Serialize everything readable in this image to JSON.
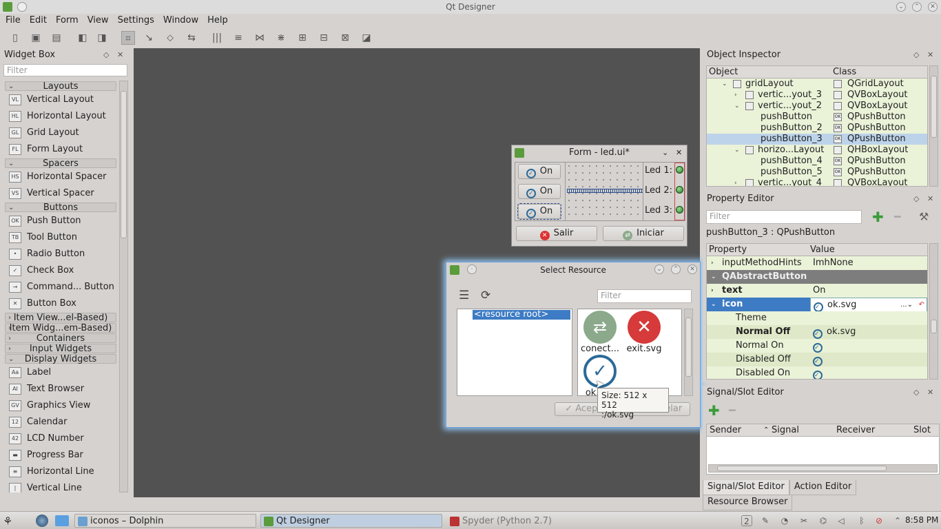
{
  "window": {
    "title": "Qt Designer"
  },
  "menu": [
    "File",
    "Edit",
    "Form",
    "View",
    "Settings",
    "Window",
    "Help"
  ],
  "widget_box": {
    "title": "Widget Box",
    "filter_placeholder": "Filter",
    "sections": [
      {
        "type": "cat",
        "label": "Layouts",
        "open": true
      },
      {
        "type": "item",
        "label": "Vertical Layout",
        "icon": "VL"
      },
      {
        "type": "item",
        "label": "Horizontal Layout",
        "icon": "HL"
      },
      {
        "type": "item",
        "label": "Grid Layout",
        "icon": "GL"
      },
      {
        "type": "item",
        "label": "Form Layout",
        "icon": "FL"
      },
      {
        "type": "cat",
        "label": "Spacers",
        "open": true
      },
      {
        "type": "item",
        "label": "Horizontal Spacer",
        "icon": "HS"
      },
      {
        "type": "item",
        "label": "Vertical Spacer",
        "icon": "VS"
      },
      {
        "type": "cat",
        "label": "Buttons",
        "open": true
      },
      {
        "type": "item",
        "label": "Push Button",
        "icon": "OK"
      },
      {
        "type": "item",
        "label": "Tool Button",
        "icon": "TB"
      },
      {
        "type": "item",
        "label": "Radio Button",
        "icon": "•"
      },
      {
        "type": "item",
        "label": "Check Box",
        "icon": "✓"
      },
      {
        "type": "item",
        "label": "Command... Button",
        "icon": "→"
      },
      {
        "type": "item",
        "label": "Button Box",
        "icon": "✕"
      },
      {
        "type": "cat",
        "label": "Item View...el-Based)",
        "open": false
      },
      {
        "type": "cat",
        "label": "Item Widg...em-Based)",
        "open": false
      },
      {
        "type": "cat",
        "label": "Containers",
        "open": false
      },
      {
        "type": "cat",
        "label": "Input Widgets",
        "open": false
      },
      {
        "type": "cat",
        "label": "Display Widgets",
        "open": true
      },
      {
        "type": "item",
        "label": "Label",
        "icon": "Aa"
      },
      {
        "type": "item",
        "label": "Text Browser",
        "icon": "AI"
      },
      {
        "type": "item",
        "label": "Graphics View",
        "icon": "GV"
      },
      {
        "type": "item",
        "label": "Calendar",
        "icon": "12"
      },
      {
        "type": "item",
        "label": "LCD Number",
        "icon": "42"
      },
      {
        "type": "item",
        "label": "Progress Bar",
        "icon": "▬"
      },
      {
        "type": "item",
        "label": "Horizontal Line",
        "icon": "≡"
      },
      {
        "type": "item",
        "label": "Vertical Line",
        "icon": "|"
      }
    ]
  },
  "form": {
    "title": "Form - led.ui*",
    "on_label": "On",
    "leds": [
      "Led 1:",
      "Led 2:",
      "Led 3:"
    ],
    "salir": "Salir",
    "iniciar": "Iniciar"
  },
  "dialog": {
    "title": "Select Resource",
    "filter_placeholder": "Filter",
    "tree_root": "<resource root>",
    "files": [
      "conect...",
      "exit.svg",
      "ok.svg"
    ],
    "ok_label": "Aceptar",
    "cancel_label": "Cancelar",
    "tooltip_line1": "Size: 512 x 512",
    "tooltip_line2": ":/ok.svg"
  },
  "object_inspector": {
    "title": "Object Inspector",
    "col_object": "Object",
    "col_class": "Class",
    "rows": [
      {
        "name": "gridLayout",
        "cls": "QGridLayout",
        "depth": 0,
        "arrow": "⌄"
      },
      {
        "name": "vertic...yout_3",
        "cls": "QVBoxLayout",
        "depth": 1,
        "arrow": "›"
      },
      {
        "name": "vertic...yout_2",
        "cls": "QVBoxLayout",
        "depth": 1,
        "arrow": "⌄"
      },
      {
        "name": "pushButton",
        "cls": "QPushButton",
        "depth": 2,
        "arrow": ""
      },
      {
        "name": "pushButton_2",
        "cls": "QPushButton",
        "depth": 2,
        "arrow": ""
      },
      {
        "name": "pushButton_3",
        "cls": "QPushButton",
        "depth": 2,
        "arrow": "",
        "selected": true
      },
      {
        "name": "horizo...Layout",
        "cls": "QHBoxLayout",
        "depth": 1,
        "arrow": "⌄"
      },
      {
        "name": "pushButton_4",
        "cls": "QPushButton",
        "depth": 2,
        "arrow": ""
      },
      {
        "name": "pushButton_5",
        "cls": "QPushButton",
        "depth": 2,
        "arrow": ""
      },
      {
        "name": "vertic...yout_4",
        "cls": "QVBoxLayout",
        "depth": 1,
        "arrow": "›"
      }
    ]
  },
  "property_editor": {
    "title": "Property Editor",
    "filter_placeholder": "Filter",
    "object_label": "pushButton_3 : QPushButton",
    "col_property": "Property",
    "col_value": "Value",
    "rows": [
      {
        "name": "inputMethodHints",
        "value": "ImhNone",
        "kind": "normal",
        "indent": 1,
        "arrow": "›"
      },
      {
        "name": "QAbstractButton",
        "value": "",
        "kind": "group",
        "indent": 0,
        "arrow": "⌄"
      },
      {
        "name": "text",
        "value": "On",
        "kind": "bold",
        "indent": 1,
        "arrow": "›"
      },
      {
        "name": "icon",
        "value": "ok.svg",
        "kind": "sel",
        "indent": 1,
        "arrow": "⌄"
      },
      {
        "name": "Theme",
        "value": "",
        "kind": "normal",
        "indent": 2,
        "arrow": ""
      },
      {
        "name": "Normal Off",
        "value": "ok.svg",
        "kind": "bold",
        "indent": 2,
        "arrow": ""
      },
      {
        "name": "Normal On",
        "value": "",
        "kind": "normal",
        "indent": 2,
        "arrow": ""
      },
      {
        "name": "Disabled Off",
        "value": "",
        "kind": "normal",
        "indent": 2,
        "arrow": ""
      },
      {
        "name": "Disabled On",
        "value": "",
        "kind": "normal",
        "indent": 2,
        "arrow": ""
      }
    ]
  },
  "signal_slot": {
    "title": "Signal/Slot Editor",
    "cols": [
      "Sender",
      "Signal",
      "Receiver",
      "Slot"
    ]
  },
  "bottom_tabs": [
    "Signal/Slot Editor",
    "Action Editor",
    "Resource Browser"
  ],
  "taskbar": {
    "tasks": [
      "iconos – Dolphin",
      "Qt Designer",
      "Spyder (Python 2.7)"
    ],
    "badge": "2",
    "clock": "8:58 PM"
  }
}
